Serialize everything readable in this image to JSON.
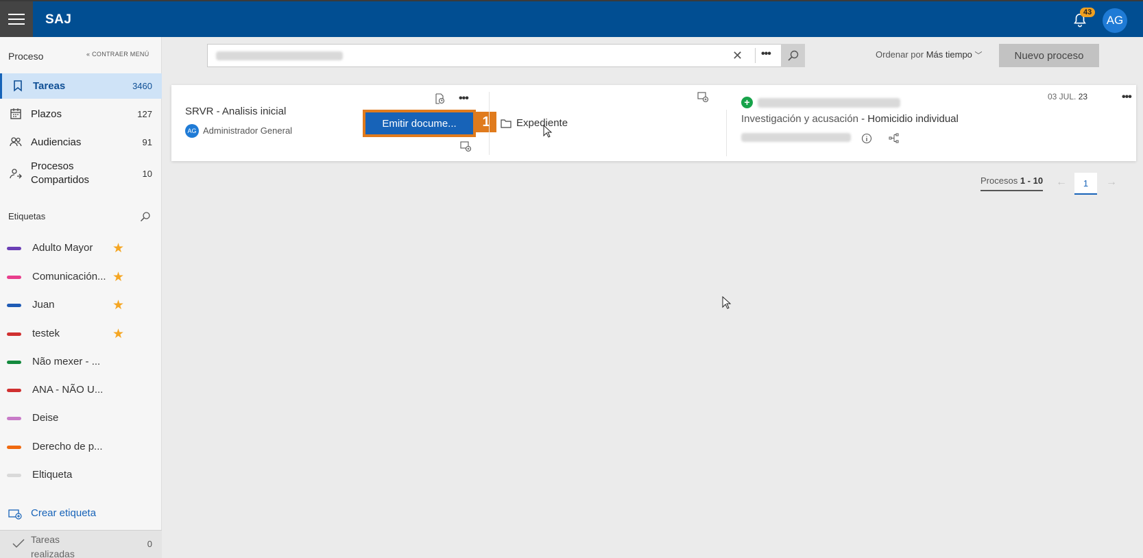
{
  "header": {
    "app_name": "SAJ",
    "notification_count": "43",
    "user_initials": "AG",
    "colors": {
      "brand": "#014e92",
      "accent": "#e07b1d",
      "primary": "#1763b8"
    }
  },
  "sidebar": {
    "section_title": "Proceso",
    "collapse_label": "« CONTRAER MENÚ",
    "items": [
      {
        "label": "Tareas",
        "count": "3460",
        "icon": "bookmark-icon",
        "active": true
      },
      {
        "label": "Plazos",
        "count": "127",
        "icon": "calendar-icon"
      },
      {
        "label": "Audiencias",
        "count": "91",
        "icon": "people-icon"
      },
      {
        "label": "Procesos Compartidos",
        "count": "10",
        "icon": "shared-people-icon"
      }
    ],
    "tags_title": "Etiquetas",
    "tags": [
      {
        "label": "Adulto Mayor",
        "color": "#6b3fb5",
        "starred": true
      },
      {
        "label": "Comunicación...",
        "color": "#e83e8c",
        "starred": true
      },
      {
        "label": "Juan",
        "color": "#1f5bb5",
        "starred": true
      },
      {
        "label": "testek",
        "color": "#d03030",
        "starred": true
      },
      {
        "label": "Não mexer - ...",
        "color": "#13893d",
        "starred": false
      },
      {
        "label": "ANA - NÃO U...",
        "color": "#d03030",
        "starred": false
      },
      {
        "label": "Deise",
        "color": "#c87bc8",
        "starred": false
      },
      {
        "label": "Derecho de p...",
        "color": "#f06a10",
        "starred": false
      },
      {
        "label": "Eltiqueta",
        "color": "#d9d9d9",
        "starred": false
      }
    ],
    "create_tag_label": "Crear etiqueta",
    "done_label": "Tareas realizadas",
    "done_count": "0"
  },
  "toolbar": {
    "sort_prefix": "Ordenar por",
    "sort_value": "Más tiempo",
    "new_process_label": "Nuevo proceso"
  },
  "card": {
    "title": "SRVR - Analisis inicial",
    "assignee_initials": "AG",
    "assignee": "Administrador General",
    "emit_label": "Emitir docume...",
    "step_number": "1",
    "expediente_label": "Expediente",
    "date_prefix": "03 JUL.",
    "date_year": "23",
    "category": "Investigación y acusación",
    "subcategory": "- Homicidio individual"
  },
  "pagination": {
    "label_prefix": "Procesos",
    "range": "1 - 10",
    "current_page": "1"
  }
}
